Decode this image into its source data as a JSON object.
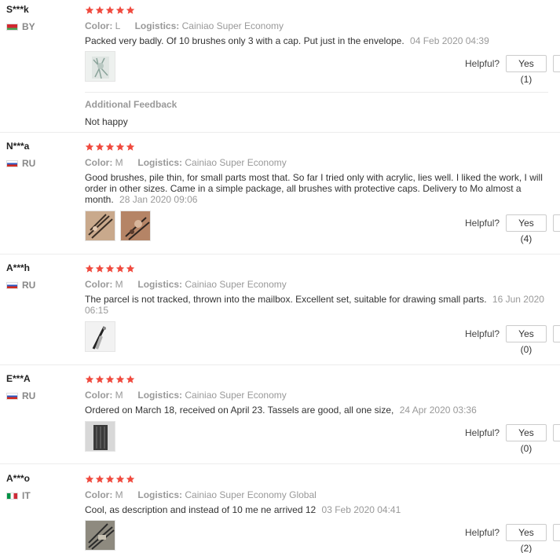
{
  "reviews": [
    {
      "user": "S***k",
      "country": "BY",
      "flag": [
        "#d22730",
        "#4aa657"
      ],
      "stars": 5,
      "color_label": "Color:",
      "color_value": "L",
      "logistics_label": "Logistics:",
      "logistics_value": "Cainiao Super Economy",
      "text": "Packed very badly. Of 10 brushes only 3 with a cap. Put just in the envelope.",
      "date": "04 Feb 2020 04:39",
      "photos": [
        "photo-1"
      ],
      "helpful_label": "Helpful?",
      "yes_label": "Yes (1)",
      "additional": {
        "title": "Additional Feedback",
        "text": "Not happy"
      }
    },
    {
      "user": "N***a",
      "country": "RU",
      "flag": [
        "#ffffff",
        "#2b59c3",
        "#d52b1e"
      ],
      "stars": 5,
      "color_label": "Color:",
      "color_value": "M",
      "logistics_label": "Logistics:",
      "logistics_value": "Cainiao Super Economy",
      "text": "Good brushes, pile thin, for small parts most that. So far I tried only with acrylic, lies well. I liked the work, I will order in other sizes. Came in a simple package, all brushes with protective caps. Delivery to Mo almost a month.",
      "date": "28 Jan 2020 09:06",
      "photos": [
        "photo-1",
        "photo-2"
      ],
      "helpful_label": "Helpful?",
      "yes_label": "Yes (4)"
    },
    {
      "user": "A***h",
      "country": "RU",
      "flag": [
        "#ffffff",
        "#2b59c3",
        "#d52b1e"
      ],
      "stars": 5,
      "color_label": "Color:",
      "color_value": "M",
      "logistics_label": "Logistics:",
      "logistics_value": "Cainiao Super Economy",
      "text": "The parcel is not tracked, thrown into the mailbox. Excellent set, suitable for drawing small parts.",
      "date": "16 Jun 2020 06:15",
      "photos": [
        "photo-1"
      ],
      "helpful_label": "Helpful?",
      "yes_label": "Yes (0)"
    },
    {
      "user": "E***A",
      "country": "RU",
      "flag": [
        "#ffffff",
        "#2b59c3",
        "#d52b1e"
      ],
      "stars": 5,
      "color_label": "Color:",
      "color_value": "M",
      "logistics_label": "Logistics:",
      "logistics_value": "Cainiao Super Economy",
      "text": "Ordered on March 18, received on April 23. Tassels are good, all one size,",
      "date": "24 Apr 2020 03:36",
      "photos": [
        "photo-1"
      ],
      "helpful_label": "Helpful?",
      "yes_label": "Yes (0)"
    },
    {
      "user": "A***o",
      "country": "IT",
      "flag": [
        "#009246",
        "#ffffff",
        "#ce2b37"
      ],
      "stars": 5,
      "color_label": "Color:",
      "color_value": "M",
      "logistics_label": "Logistics:",
      "logistics_value": "Cainiao Super Economy Global",
      "text": "Cool, as description and instead of 10 me ne arrived 12",
      "date": "03 Feb 2020 04:41",
      "photos": [
        "photo-1"
      ],
      "helpful_label": "Helpful?",
      "yes_label": "Yes (2)"
    }
  ],
  "colors": {
    "star": "#f04a3e",
    "text": "#333333",
    "muted": "#999999",
    "border": "#ececec"
  }
}
